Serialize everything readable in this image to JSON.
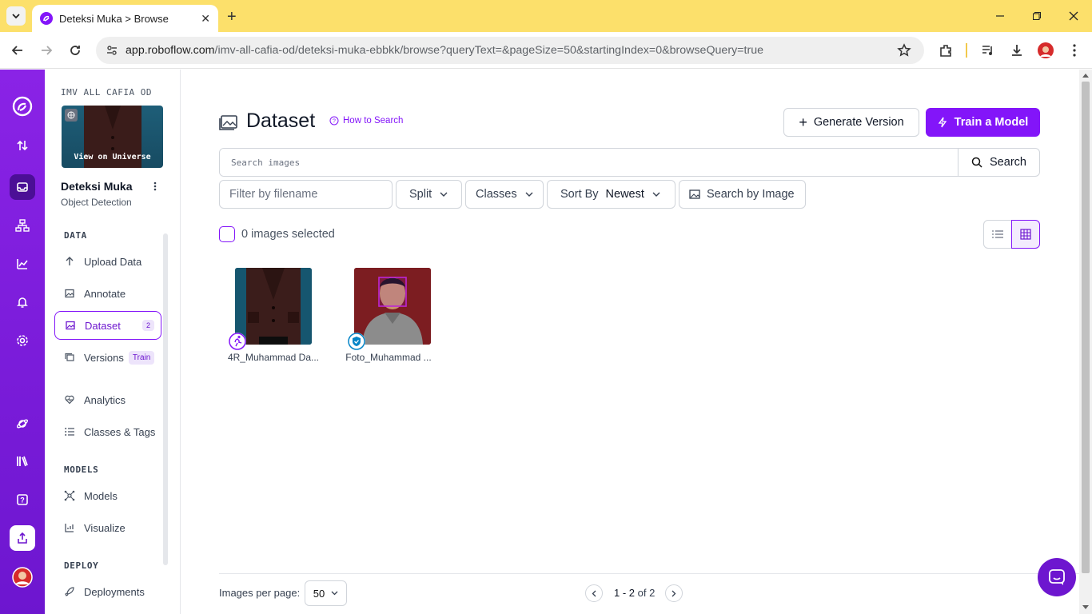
{
  "browser": {
    "tab_title": "Deteksi Muka > Browse",
    "url_host": "app.roboflow.com",
    "url_path": "/imv-all-cafia-od/deteksi-muka-ebbkk/browse?queryText=&pageSize=50&startingIndex=0&browseQuery=true"
  },
  "sidebar": {
    "workspace": "IMV ALL CAFIA OD",
    "thumb_label": "View on Universe",
    "project_name": "Deteksi Muka",
    "project_type": "Object Detection",
    "sections": {
      "data": "DATA",
      "models": "MODELS",
      "deploy": "DEPLOY"
    },
    "items": [
      {
        "label": "Upload Data",
        "icon": "arrow-up-icon"
      },
      {
        "label": "Annotate",
        "icon": "image-icon"
      },
      {
        "label": "Dataset",
        "icon": "images-icon",
        "badge": "2"
      },
      {
        "label": "Versions",
        "icon": "versions-icon",
        "tag": "Train"
      },
      {
        "label": "Analytics",
        "icon": "heart-pulse-icon"
      },
      {
        "label": "Classes & Tags",
        "icon": "list-icon"
      },
      {
        "label": "Models",
        "icon": "network-icon"
      },
      {
        "label": "Visualize",
        "icon": "chart-icon"
      },
      {
        "label": "Deployments",
        "icon": "rocket-icon"
      }
    ]
  },
  "main": {
    "title": "Dataset",
    "how_to_search": "How to Search",
    "generate_version": "Generate Version",
    "train_model": "Train a Model",
    "search_placeholder": "Search images",
    "search_button": "Search",
    "filter_placeholder": "Filter by filename",
    "split": "Split",
    "classes": "Classes",
    "sort_by": "Sort By",
    "sort_value": "Newest",
    "search_by_image": "Search by Image",
    "selected_text": "0 images selected",
    "images": [
      {
        "name": "4R_Muhammad Da...",
        "status": "annotating"
      },
      {
        "name": "Foto_Muhammad ...",
        "status": "approved"
      }
    ],
    "images_per_page_label": "Images per page:",
    "images_per_page": "50",
    "page_range": "1 - 2",
    "page_of": "of 2"
  },
  "colors": {
    "accent": "#8315f9",
    "rail": "#7a1ddc",
    "tabbar": "#fce06b"
  }
}
